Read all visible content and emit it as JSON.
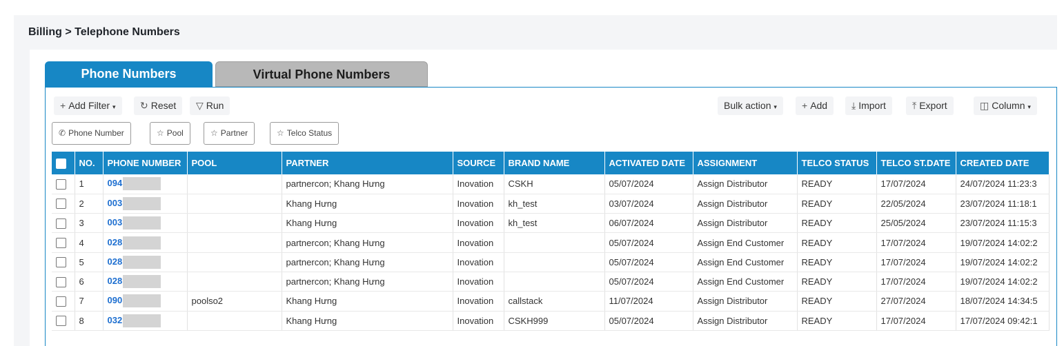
{
  "breadcrumb": "Billing > Telephone Numbers",
  "tabs": [
    {
      "label": "Phone Numbers",
      "active": true
    },
    {
      "label": "Virtual Phone Numbers",
      "active": false
    }
  ],
  "toolbar": {
    "add_filter": "Add Filter",
    "reset": "Reset",
    "run": "Run",
    "bulk_action": "Bulk action",
    "add": "Add",
    "import": "Import",
    "export": "Export",
    "column": "Column"
  },
  "filters": [
    "Phone Number",
    "Pool",
    "Partner",
    "Telco Status"
  ],
  "table": {
    "headers": [
      "NO.",
      "PHONE NUMBER",
      "POOL",
      "PARTNER",
      "SOURCE",
      "BRAND NAME",
      "ACTIVATED DATE",
      "ASSIGNMENT",
      "TELCO STATUS",
      "TELCO ST.DATE",
      "CREATED DATE"
    ],
    "rows": [
      {
        "no": "1",
        "phone": "094",
        "pool": "",
        "partner": "partnercon; Khang Hưng",
        "source": "Inovation",
        "brand": "CSKH",
        "activated": "05/07/2024",
        "assignment": "Assign Distributor",
        "telco_status": "READY",
        "telco_date": "17/07/2024",
        "created": "24/07/2024 11:23:3"
      },
      {
        "no": "2",
        "phone": "003",
        "pool": "",
        "partner": "Khang Hưng",
        "source": "Inovation",
        "brand": "kh_test",
        "activated": "03/07/2024",
        "assignment": "Assign Distributor",
        "telco_status": "READY",
        "telco_date": "22/05/2024",
        "created": "23/07/2024 11:18:1"
      },
      {
        "no": "3",
        "phone": "003",
        "pool": "",
        "partner": "Khang Hưng",
        "source": "Inovation",
        "brand": "kh_test",
        "activated": "06/07/2024",
        "assignment": "Assign Distributor",
        "telco_status": "READY",
        "telco_date": "25/05/2024",
        "created": "23/07/2024 11:15:3"
      },
      {
        "no": "4",
        "phone": "028",
        "pool": "",
        "partner": "partnercon; Khang Hưng",
        "source": "Inovation",
        "brand": "",
        "activated": "05/07/2024",
        "assignment": "Assign End Customer",
        "telco_status": "READY",
        "telco_date": "17/07/2024",
        "created": "19/07/2024 14:02:2"
      },
      {
        "no": "5",
        "phone": "028",
        "pool": "",
        "partner": "partnercon; Khang Hưng",
        "source": "Inovation",
        "brand": "",
        "activated": "05/07/2024",
        "assignment": "Assign End Customer",
        "telco_status": "READY",
        "telco_date": "17/07/2024",
        "created": "19/07/2024 14:02:2"
      },
      {
        "no": "6",
        "phone": "028",
        "pool": "",
        "partner": "partnercon; Khang Hưng",
        "source": "Inovation",
        "brand": "",
        "activated": "05/07/2024",
        "assignment": "Assign End Customer",
        "telco_status": "READY",
        "telco_date": "17/07/2024",
        "created": "19/07/2024 14:02:2"
      },
      {
        "no": "7",
        "phone": "090",
        "pool": "poolso2",
        "partner": "Khang Hưng",
        "source": "Inovation",
        "brand": "callstack",
        "activated": "11/07/2024",
        "assignment": "Assign Distributor",
        "telco_status": "READY",
        "telco_date": "27/07/2024",
        "created": "18/07/2024 14:34:5"
      },
      {
        "no": "8",
        "phone": "032",
        "pool": "",
        "partner": "Khang Hưng",
        "source": "Inovation",
        "brand": "CSKH999",
        "activated": "05/07/2024",
        "assignment": "Assign Distributor",
        "telco_status": "READY",
        "telco_date": "17/07/2024",
        "created": "17/07/2024 09:42:1"
      }
    ]
  }
}
